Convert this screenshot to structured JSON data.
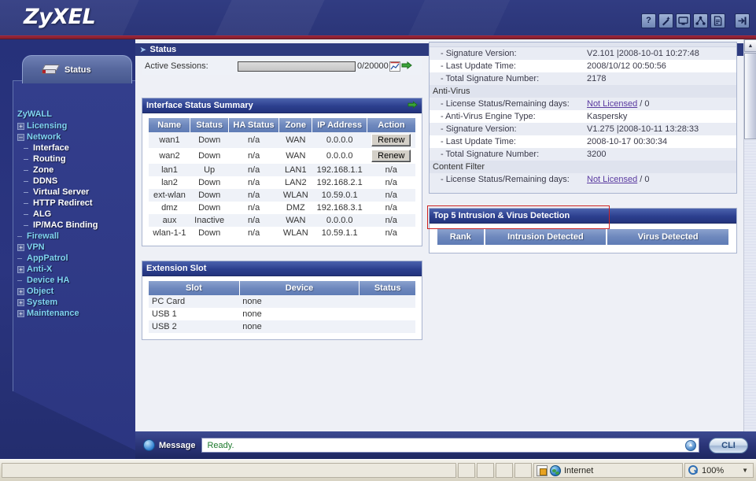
{
  "header": {
    "logo": "ZyXEL",
    "icons": [
      {
        "name": "help-icon",
        "glyph": "?"
      },
      {
        "name": "wizard-icon",
        "glyph": "wand"
      },
      {
        "name": "console-icon",
        "glyph": "monitor"
      },
      {
        "name": "site-map-icon",
        "glyph": "sitemap"
      },
      {
        "name": "about-icon",
        "glyph": "document"
      },
      {
        "name": "logout-icon",
        "glyph": "logout"
      }
    ]
  },
  "sidebar": {
    "tab_label": "Status",
    "root": "ZyWALL",
    "items": [
      {
        "label": "Licensing",
        "toggle": "+",
        "level": 0
      },
      {
        "label": "Network",
        "toggle": "-",
        "level": 0
      },
      {
        "label": "Interface",
        "toggle": "",
        "level": 1
      },
      {
        "label": "Routing",
        "toggle": "",
        "level": 1
      },
      {
        "label": "Zone",
        "toggle": "",
        "level": 1
      },
      {
        "label": "DDNS",
        "toggle": "",
        "level": 1
      },
      {
        "label": "Virtual Server",
        "toggle": "",
        "level": 1
      },
      {
        "label": "HTTP Redirect",
        "toggle": "",
        "level": 1
      },
      {
        "label": "ALG",
        "toggle": "",
        "level": 1
      },
      {
        "label": "IP/MAC Binding",
        "toggle": "",
        "level": 1
      },
      {
        "label": "Firewall",
        "toggle": "",
        "level": 0
      },
      {
        "label": "VPN",
        "toggle": "+",
        "level": 0
      },
      {
        "label": "AppPatrol",
        "toggle": "",
        "level": 0
      },
      {
        "label": "Anti-X",
        "toggle": "+",
        "level": 0
      },
      {
        "label": "Device HA",
        "toggle": "",
        "level": 0
      },
      {
        "label": "Object",
        "toggle": "+",
        "level": 0
      },
      {
        "label": "System",
        "toggle": "+",
        "level": 0
      },
      {
        "label": "Maintenance",
        "toggle": "+",
        "level": 0
      }
    ]
  },
  "content": {
    "page_title": "Status",
    "active_sessions": {
      "label": "Active Sessions:",
      "value": "0/20000"
    },
    "interface_status": {
      "title": "Interface Status Summary",
      "columns": [
        "Name",
        "Status",
        "HA Status",
        "Zone",
        "IP Address",
        "Action"
      ],
      "rows": [
        {
          "name": "wan1",
          "status": "Down",
          "ha": "n/a",
          "zone": "WAN",
          "ip": "0.0.0.0",
          "action": "Renew",
          "action_is_button": true
        },
        {
          "name": "wan2",
          "status": "Down",
          "ha": "n/a",
          "zone": "WAN",
          "ip": "0.0.0.0",
          "action": "Renew",
          "action_is_button": true
        },
        {
          "name": "lan1",
          "status": "Up",
          "ha": "n/a",
          "zone": "LAN1",
          "ip": "192.168.1.1",
          "action": "n/a",
          "action_is_button": false
        },
        {
          "name": "lan2",
          "status": "Down",
          "ha": "n/a",
          "zone": "LAN2",
          "ip": "192.168.2.1",
          "action": "n/a",
          "action_is_button": false
        },
        {
          "name": "ext-wlan",
          "status": "Down",
          "ha": "n/a",
          "zone": "WLAN",
          "ip": "10.59.0.1",
          "action": "n/a",
          "action_is_button": false
        },
        {
          "name": "dmz",
          "status": "Down",
          "ha": "n/a",
          "zone": "DMZ",
          "ip": "192.168.3.1",
          "action": "n/a",
          "action_is_button": false
        },
        {
          "name": "aux",
          "status": "Inactive",
          "ha": "n/a",
          "zone": "WAN",
          "ip": "0.0.0.0",
          "action": "n/a",
          "action_is_button": false
        },
        {
          "name": "wlan-1-1",
          "status": "Down",
          "ha": "n/a",
          "zone": "WLAN",
          "ip": "10.59.1.1",
          "action": "n/a",
          "action_is_button": false
        }
      ]
    },
    "extension_slot": {
      "title": "Extension Slot",
      "columns": [
        "Slot",
        "Device",
        "Status"
      ],
      "rows": [
        {
          "slot": "PC Card",
          "device": "none",
          "status": ""
        },
        {
          "slot": "USB 1",
          "device": "none",
          "status": ""
        },
        {
          "slot": "USB 2",
          "device": "none",
          "status": ""
        }
      ]
    },
    "license_details": {
      "rows": [
        {
          "key": "- Signature Version:",
          "value": "V2.101 |2008-10-01 10:27:48",
          "type": "detail",
          "shade": true
        },
        {
          "key": "- Last Update Time:",
          "value": "2008/10/12 00:50:56",
          "type": "detail",
          "shade": false
        },
        {
          "key": "- Total Signature Number:",
          "value": "2178",
          "type": "detail",
          "shade": true
        },
        {
          "key": "Anti-Virus",
          "value": "",
          "type": "group",
          "shade": false
        },
        {
          "key": "- License Status/Remaining days:",
          "value": "Not Licensed",
          "value_suffix": " / 0",
          "link": true,
          "type": "detail",
          "shade": true
        },
        {
          "key": "- Anti-Virus Engine Type:",
          "value": "Kaspersky",
          "type": "detail",
          "shade": false
        },
        {
          "key": "- Signature Version:",
          "value": "V1.275 |2008-10-11 13:28:33",
          "type": "detail",
          "shade": true
        },
        {
          "key": "- Last Update Time:",
          "value": "2008-10-17 00:30:34",
          "type": "detail",
          "shade": false
        },
        {
          "key": "- Total Signature Number:",
          "value": "3200",
          "type": "detail",
          "shade": true
        },
        {
          "key": "Content Filter",
          "value": "",
          "type": "group",
          "shade": false
        },
        {
          "key": "- License Status/Remaining days:",
          "value": "Not Licensed",
          "value_suffix": " / 0",
          "link": true,
          "type": "detail",
          "shade": true
        }
      ]
    },
    "top5": {
      "title": "Top 5 Intrusion & Virus Detection",
      "columns": [
        "Rank",
        "Intrusion Detected",
        "Virus Detected"
      ],
      "rows": [],
      "highlight_color": "#cc2222"
    }
  },
  "message_bar": {
    "label": "Message",
    "value": "Ready.",
    "cli_label": "CLI"
  },
  "status_bar": {
    "zone": "Internet",
    "zoom": "100%"
  }
}
